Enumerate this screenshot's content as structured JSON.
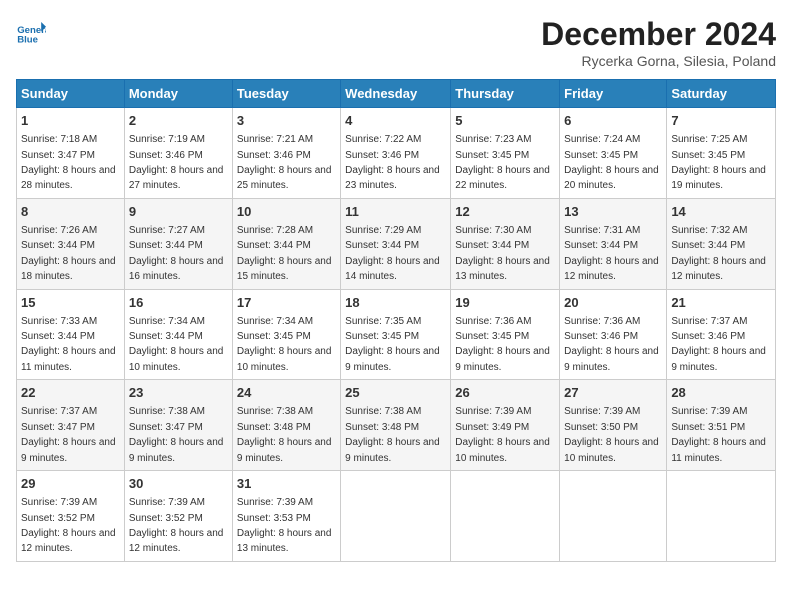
{
  "logo": {
    "line1": "General",
    "line2": "Blue"
  },
  "title": "December 2024",
  "subtitle": "Rycerka Gorna, Silesia, Poland",
  "days_of_week": [
    "Sunday",
    "Monday",
    "Tuesday",
    "Wednesday",
    "Thursday",
    "Friday",
    "Saturday"
  ],
  "weeks": [
    [
      {
        "day": 1,
        "sunrise": "7:18 AM",
        "sunset": "3:47 PM",
        "daylight": "8 hours and 28 minutes."
      },
      {
        "day": 2,
        "sunrise": "7:19 AM",
        "sunset": "3:46 PM",
        "daylight": "8 hours and 27 minutes."
      },
      {
        "day": 3,
        "sunrise": "7:21 AM",
        "sunset": "3:46 PM",
        "daylight": "8 hours and 25 minutes."
      },
      {
        "day": 4,
        "sunrise": "7:22 AM",
        "sunset": "3:46 PM",
        "daylight": "8 hours and 23 minutes."
      },
      {
        "day": 5,
        "sunrise": "7:23 AM",
        "sunset": "3:45 PM",
        "daylight": "8 hours and 22 minutes."
      },
      {
        "day": 6,
        "sunrise": "7:24 AM",
        "sunset": "3:45 PM",
        "daylight": "8 hours and 20 minutes."
      },
      {
        "day": 7,
        "sunrise": "7:25 AM",
        "sunset": "3:45 PM",
        "daylight": "8 hours and 19 minutes."
      }
    ],
    [
      {
        "day": 8,
        "sunrise": "7:26 AM",
        "sunset": "3:44 PM",
        "daylight": "8 hours and 18 minutes."
      },
      {
        "day": 9,
        "sunrise": "7:27 AM",
        "sunset": "3:44 PM",
        "daylight": "8 hours and 16 minutes."
      },
      {
        "day": 10,
        "sunrise": "7:28 AM",
        "sunset": "3:44 PM",
        "daylight": "8 hours and 15 minutes."
      },
      {
        "day": 11,
        "sunrise": "7:29 AM",
        "sunset": "3:44 PM",
        "daylight": "8 hours and 14 minutes."
      },
      {
        "day": 12,
        "sunrise": "7:30 AM",
        "sunset": "3:44 PM",
        "daylight": "8 hours and 13 minutes."
      },
      {
        "day": 13,
        "sunrise": "7:31 AM",
        "sunset": "3:44 PM",
        "daylight": "8 hours and 12 minutes."
      },
      {
        "day": 14,
        "sunrise": "7:32 AM",
        "sunset": "3:44 PM",
        "daylight": "8 hours and 12 minutes."
      }
    ],
    [
      {
        "day": 15,
        "sunrise": "7:33 AM",
        "sunset": "3:44 PM",
        "daylight": "8 hours and 11 minutes."
      },
      {
        "day": 16,
        "sunrise": "7:34 AM",
        "sunset": "3:44 PM",
        "daylight": "8 hours and 10 minutes."
      },
      {
        "day": 17,
        "sunrise": "7:34 AM",
        "sunset": "3:45 PM",
        "daylight": "8 hours and 10 minutes."
      },
      {
        "day": 18,
        "sunrise": "7:35 AM",
        "sunset": "3:45 PM",
        "daylight": "8 hours and 9 minutes."
      },
      {
        "day": 19,
        "sunrise": "7:36 AM",
        "sunset": "3:45 PM",
        "daylight": "8 hours and 9 minutes."
      },
      {
        "day": 20,
        "sunrise": "7:36 AM",
        "sunset": "3:46 PM",
        "daylight": "8 hours and 9 minutes."
      },
      {
        "day": 21,
        "sunrise": "7:37 AM",
        "sunset": "3:46 PM",
        "daylight": "8 hours and 9 minutes."
      }
    ],
    [
      {
        "day": 22,
        "sunrise": "7:37 AM",
        "sunset": "3:47 PM",
        "daylight": "8 hours and 9 minutes."
      },
      {
        "day": 23,
        "sunrise": "7:38 AM",
        "sunset": "3:47 PM",
        "daylight": "8 hours and 9 minutes."
      },
      {
        "day": 24,
        "sunrise": "7:38 AM",
        "sunset": "3:48 PM",
        "daylight": "8 hours and 9 minutes."
      },
      {
        "day": 25,
        "sunrise": "7:38 AM",
        "sunset": "3:48 PM",
        "daylight": "8 hours and 9 minutes."
      },
      {
        "day": 26,
        "sunrise": "7:39 AM",
        "sunset": "3:49 PM",
        "daylight": "8 hours and 10 minutes."
      },
      {
        "day": 27,
        "sunrise": "7:39 AM",
        "sunset": "3:50 PM",
        "daylight": "8 hours and 10 minutes."
      },
      {
        "day": 28,
        "sunrise": "7:39 AM",
        "sunset": "3:51 PM",
        "daylight": "8 hours and 11 minutes."
      }
    ],
    [
      {
        "day": 29,
        "sunrise": "7:39 AM",
        "sunset": "3:52 PM",
        "daylight": "8 hours and 12 minutes."
      },
      {
        "day": 30,
        "sunrise": "7:39 AM",
        "sunset": "3:52 PM",
        "daylight": "8 hours and 12 minutes."
      },
      {
        "day": 31,
        "sunrise": "7:39 AM",
        "sunset": "3:53 PM",
        "daylight": "8 hours and 13 minutes."
      },
      null,
      null,
      null,
      null
    ]
  ]
}
